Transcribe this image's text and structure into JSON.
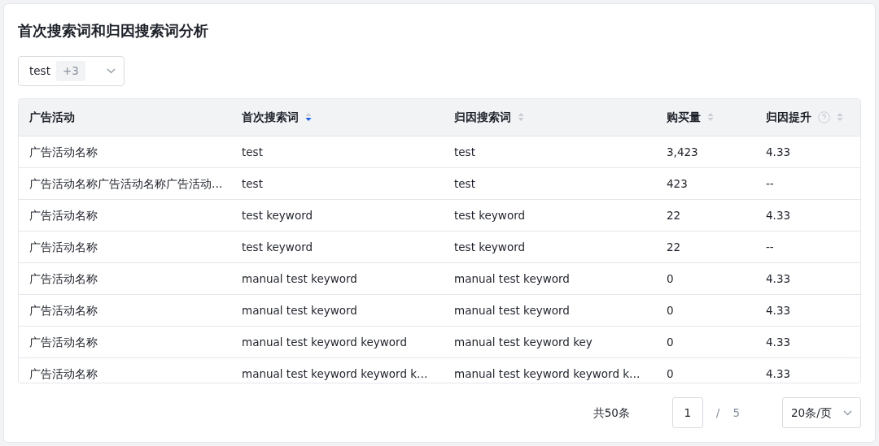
{
  "title": "首次搜索词和归因搜索词分析",
  "filter": {
    "value": "test",
    "extra_count": "+3"
  },
  "table": {
    "columns": [
      {
        "label": "广告活动",
        "kind": "plain"
      },
      {
        "label": "首次搜索词",
        "kind": "sortable",
        "sorted": true
      },
      {
        "label": "归因搜索词",
        "kind": "sortable",
        "sorted": false
      },
      {
        "label": "购买量",
        "kind": "sortable",
        "sorted": false
      },
      {
        "label": "归因提升",
        "kind": "sortable-help",
        "sorted": false
      }
    ],
    "rows": [
      [
        "广告活动名称",
        "test",
        "test",
        "3,423",
        "4.33"
      ],
      [
        "广告活动名称广告活动名称广告活动…",
        "test",
        "test",
        "423",
        "--"
      ],
      [
        "广告活动名称",
        "test keyword",
        "test keyword",
        "22",
        "4.33"
      ],
      [
        "广告活动名称",
        "test keyword",
        "test keyword",
        "22",
        "--"
      ],
      [
        "广告活动名称",
        "manual test keyword",
        "manual test keyword",
        "0",
        "4.33"
      ],
      [
        "广告活动名称",
        "manual test keyword",
        "manual test keyword",
        "0",
        "4.33"
      ],
      [
        "广告活动名称",
        "manual test keyword keyword",
        "manual test keyword key",
        "0",
        "4.33"
      ],
      [
        "广告活动名称",
        "manual test keyword keyword k…",
        "manual test keyword keyword k…",
        "0",
        "4.33"
      ]
    ]
  },
  "pagination": {
    "total": "共50条",
    "page": "1",
    "separator": "/",
    "pages": "5",
    "page_size": "20条/页"
  }
}
